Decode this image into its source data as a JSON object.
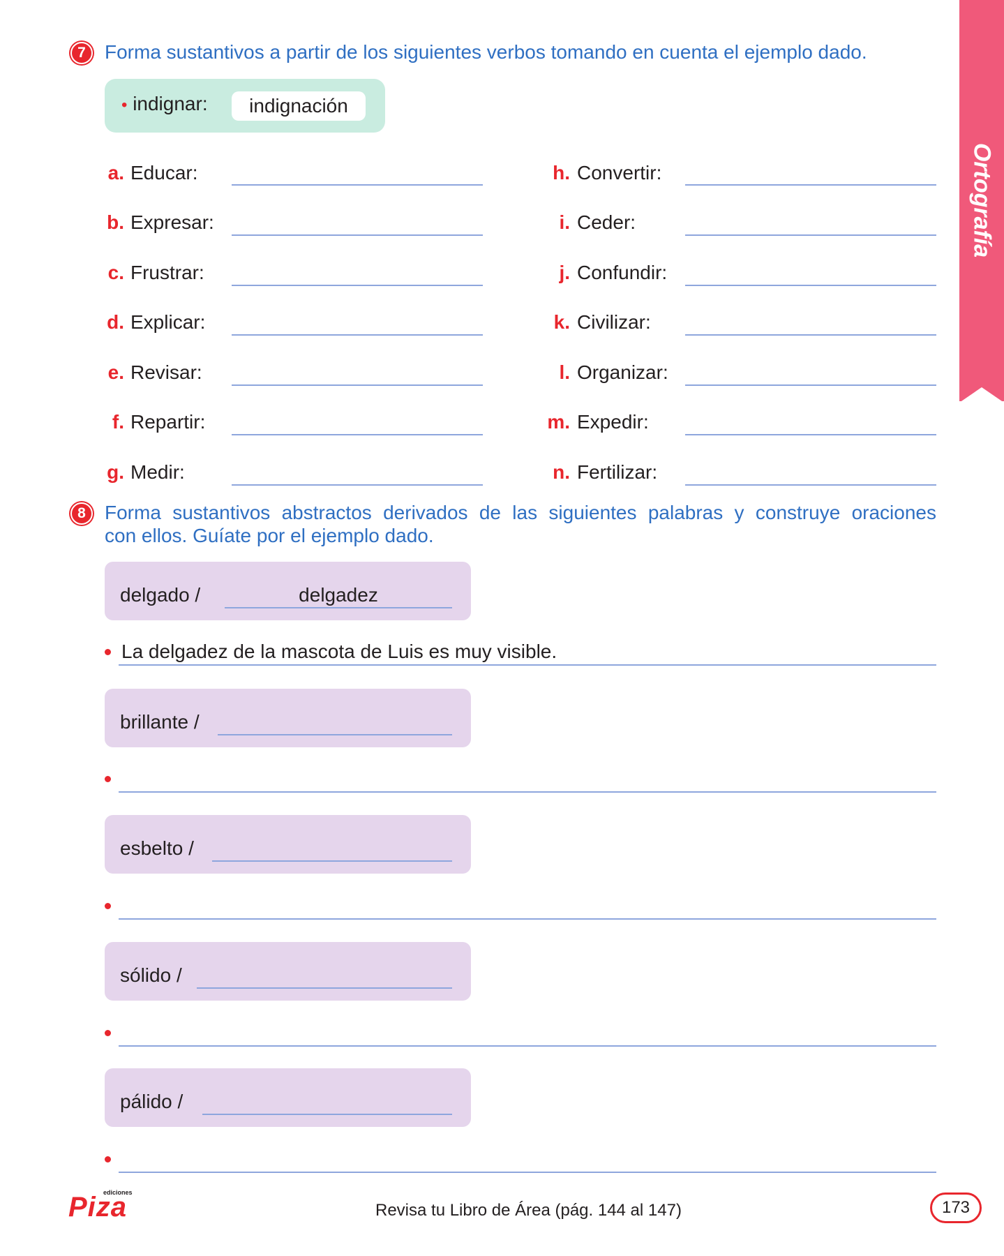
{
  "side_tab": {
    "label": "Ortografía"
  },
  "exercise7": {
    "number": "7",
    "instruction": "Forma sustantivos a partir de los siguientes verbos tomando en cuenta el ejemplo dado.",
    "example": {
      "word": "indignar:",
      "answer": "indignación"
    },
    "left_items": [
      {
        "letter": "a.",
        "word": "Educar:"
      },
      {
        "letter": "b.",
        "word": "Expresar:"
      },
      {
        "letter": "c.",
        "word": "Frustrar:"
      },
      {
        "letter": "d.",
        "word": "Explicar:"
      },
      {
        "letter": "e.",
        "word": "Revisar:"
      },
      {
        "letter": "f.",
        "word": "Repartir:"
      },
      {
        "letter": "g.",
        "word": "Medir:"
      }
    ],
    "right_items": [
      {
        "letter": "h.",
        "word": "Convertir:"
      },
      {
        "letter": "i.",
        "word": "Ceder:"
      },
      {
        "letter": "j.",
        "word": "Confundir:"
      },
      {
        "letter": "k.",
        "word": "Civilizar:"
      },
      {
        "letter": "l.",
        "word": "Organizar:"
      },
      {
        "letter": "m.",
        "word": "Expedir:"
      },
      {
        "letter": "n.",
        "word": "Fertilizar:"
      }
    ]
  },
  "exercise8": {
    "number": "8",
    "instruction_line1": "Forma sustantivos abstractos derivados de las siguientes palabras y construye oraciones",
    "instruction_line2": "con ellos. Guíate por el ejemplo dado.",
    "example": {
      "word": "delgado /",
      "answer": "delgadez",
      "sentence": "La delgadez de la mascota de Luis es muy visible."
    },
    "words": [
      {
        "word": "brillante /"
      },
      {
        "word": "esbelto /"
      },
      {
        "word": "sólido /"
      },
      {
        "word": "pálido /"
      }
    ]
  },
  "footer": {
    "publisher_small": "ediciones",
    "publisher": "Piza",
    "reference": "Revisa tu Libro de Área (pág. 144 al 147)",
    "page_number": "173"
  },
  "colors": {
    "accent_red": "#e8262d",
    "instruction_blue": "#2f6fc2",
    "tab_pink": "#f0597a",
    "example_green": "#c9ece0",
    "word_box_purple": "#e5d5ec",
    "rule_blue": "#8ea6dd"
  }
}
